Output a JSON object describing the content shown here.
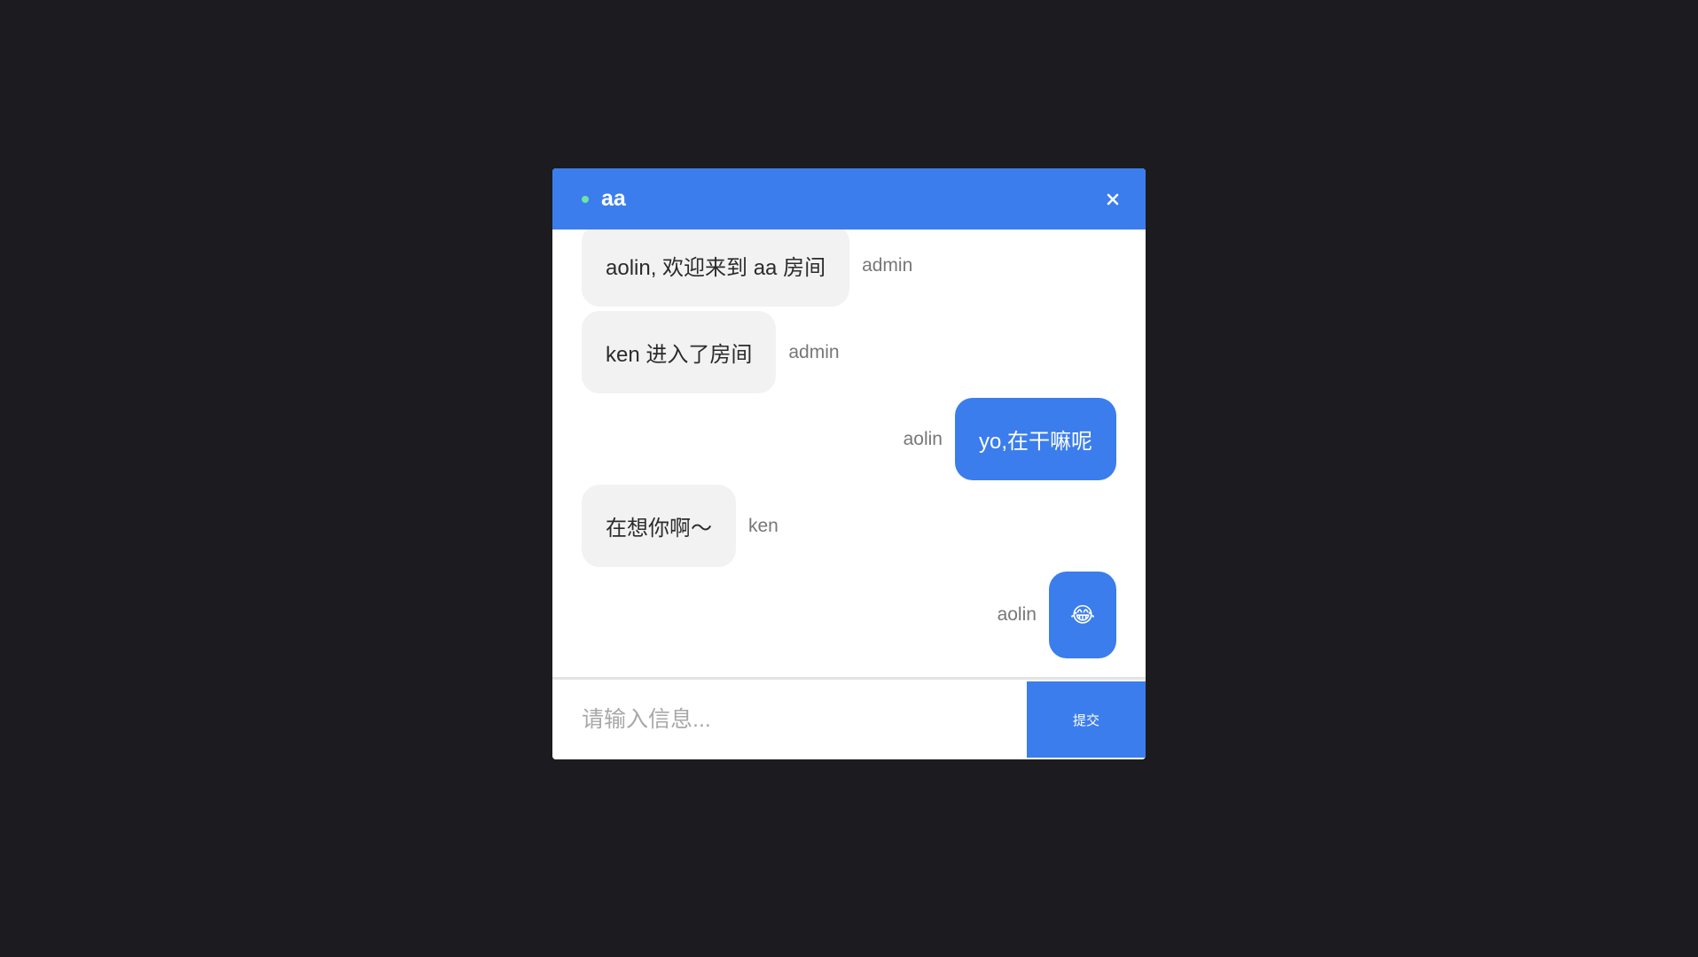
{
  "header": {
    "room_name": "aa",
    "status_color": "#6fe3a4",
    "close_icon": "close-icon"
  },
  "messages": [
    {
      "text": "aolin, 欢迎来到 aa 房间",
      "sender": "admin",
      "mine": false
    },
    {
      "text": "ken 进入了房间",
      "sender": "admin",
      "mine": false
    },
    {
      "text": "yo,在干嘛呢",
      "sender": "aolin",
      "mine": true
    },
    {
      "text": "在想你啊～",
      "sender": "ken",
      "mine": false
    },
    {
      "text": "😂",
      "sender": "aolin",
      "mine": true
    }
  ],
  "input": {
    "placeholder": "请输入信息...",
    "value": ""
  },
  "submit_label": "提交",
  "colors": {
    "accent": "#3b7ded",
    "background": "#1b1b20",
    "bubble_other": "#f2f2f2"
  }
}
